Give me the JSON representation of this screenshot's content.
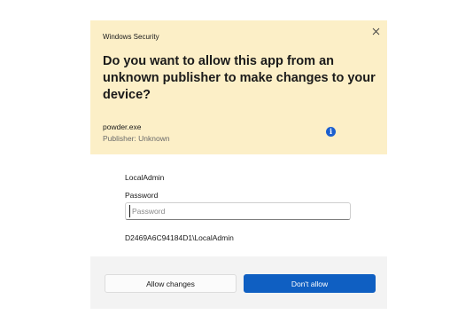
{
  "window": {
    "app_title": "Windows Security",
    "close_glyph": "✕"
  },
  "prompt": {
    "question": "Do you want to allow this app from an unknown publisher to make changes to your device?",
    "program_name": "powder.exe",
    "publisher": "Publisher: Unknown",
    "info_glyph": "i"
  },
  "credentials": {
    "account_name": "LocalAdmin",
    "password_label": "Password",
    "password_placeholder": "Password",
    "password_value": "",
    "domain_user": "D2469A6C94184D1\\LocalAdmin"
  },
  "buttons": {
    "allow_label": "Allow changes",
    "deny_label": "Don't allow"
  },
  "colors": {
    "header_bg": "#fcefc7",
    "primary_button": "#0f5fc2",
    "info_icon": "#1b5fcf",
    "footer_bg": "#f3f3f3"
  }
}
